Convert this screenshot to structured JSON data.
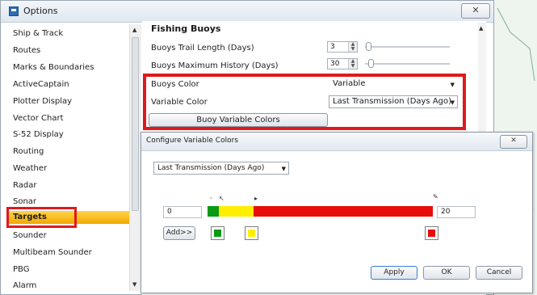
{
  "window": {
    "title": "Options",
    "close_glyph": "✕",
    "icon": "app-icon"
  },
  "sidebar": {
    "items": [
      {
        "label": "Ship & Track"
      },
      {
        "label": "Routes"
      },
      {
        "label": "Marks & Boundaries"
      },
      {
        "label": "ActiveCaptain"
      },
      {
        "label": "Plotter Display"
      },
      {
        "label": "Vector Chart"
      },
      {
        "label": "S-52 Display"
      },
      {
        "label": "Routing"
      },
      {
        "label": "Weather"
      },
      {
        "label": "Radar"
      },
      {
        "label": "Sonar"
      },
      {
        "label": "Targets",
        "selected": true
      },
      {
        "label": "Sounder"
      },
      {
        "label": "Multibeam Sounder"
      },
      {
        "label": "PBG"
      },
      {
        "label": "Alarm"
      }
    ],
    "scroll_up": "▲",
    "scroll_down": "▼"
  },
  "panel": {
    "title": "Fishing Buoys",
    "trail_label": "Buoys Trail Length (Days)",
    "trail_value": "3",
    "history_label": "Buoys Maximum History (Days)",
    "history_value": "30",
    "color_label": "Buoys Color",
    "color_value": "Variable",
    "varcolor_label": "Variable Color",
    "varcolor_value": "Last Transmission (Days Ago)",
    "buoy_colors_button": "Buoy Variable Colors"
  },
  "dialog": {
    "title": "Configure Variable Colors",
    "close_glyph": "✕",
    "dropdown_value": "Last Transmission (Days Ago)",
    "min_value": "0",
    "max_value": "20",
    "add_button": "Add>>",
    "apply_button": "Apply",
    "ok_button": "OK",
    "cancel_button": "Cancel",
    "colors": {
      "green": "#0a9a14",
      "yellow": "#ffee00",
      "red": "#e80d0d"
    }
  },
  "glyphs": {
    "caret": "▼",
    "spin_up": "▲",
    "spin_down": "▼"
  }
}
